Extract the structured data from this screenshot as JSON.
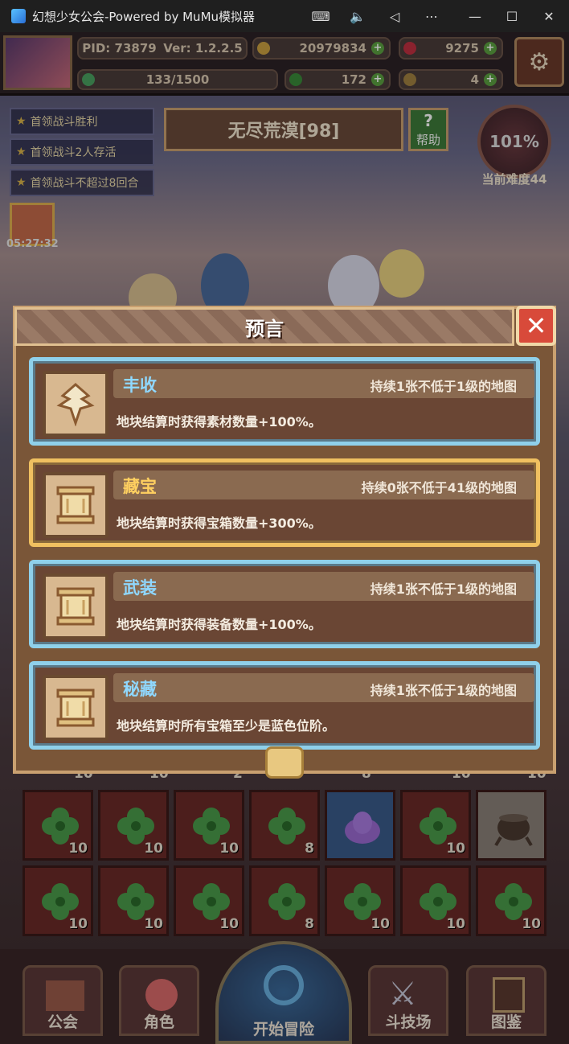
{
  "window": {
    "title": "幻想少女公会-Powered by MuMu模拟器",
    "controls": [
      "keyboard-icon",
      "volume-icon",
      "back-icon",
      "more-icon",
      "minimize-icon",
      "maximize-icon",
      "close-icon"
    ]
  },
  "status": {
    "pid": "PID: 73879",
    "version": "Ver: 1.2.2.5",
    "gold": "20979834",
    "gems": "9275",
    "stamina": "133/1500",
    "clover": "172",
    "item": "4"
  },
  "quests": [
    "首领战斗胜利",
    "首领战斗2人存活",
    "首领战斗不超过8回合"
  ],
  "stage": {
    "name": "无尽荒漠[98]",
    "help": "帮助"
  },
  "difficulty": {
    "percent": "101%",
    "label": "当前难度44"
  },
  "gift_timer": "05:27:32",
  "dialog": {
    "title": "预言",
    "cards": [
      {
        "name": "丰收",
        "condition": "持续1张不低于1级的地图",
        "desc": "地块结算时获得素材数量+100%。",
        "frame": "blue",
        "icon": "harvest-icon",
        "name_color": "#8fd8ff"
      },
      {
        "name": "藏宝",
        "condition": "持续0张不低于41级的地图",
        "desc": "地块结算时获得宝箱数量+300%。",
        "frame": "gold",
        "icon": "scroll-icon",
        "name_color": "#ffd060"
      },
      {
        "name": "武装",
        "condition": "持续1张不低于1级的地图",
        "desc": "地块结算时获得装备数量+100%。",
        "frame": "blue",
        "icon": "scroll-icon",
        "name_color": "#8fd8ff"
      },
      {
        "name": "秘藏",
        "condition": "持续1张不低于1级的地图",
        "desc": "地块结算时所有宝箱至少是蓝色位阶。",
        "frame": "blue",
        "icon": "scroll-icon",
        "name_color": "#8fd8ff"
      }
    ]
  },
  "grid_partial_counts": [
    "10",
    "10",
    "2",
    "8",
    "10",
    "10"
  ],
  "grid": {
    "row1": [
      {
        "item": "clover-icon",
        "count": "10"
      },
      {
        "item": "clover-icon",
        "count": "10"
      },
      {
        "item": "clover-icon",
        "count": "10"
      },
      {
        "item": "clover-icon",
        "count": "8"
      },
      {
        "item": "slime-icon",
        "count": ""
      },
      {
        "item": "clover-icon",
        "count": "10"
      },
      {
        "item": "cauldron-icon",
        "count": ""
      }
    ],
    "row2": [
      {
        "item": "clover-icon",
        "count": "10"
      },
      {
        "item": "clover-icon",
        "count": "10"
      },
      {
        "item": "clover-icon",
        "count": "10"
      },
      {
        "item": "clover-icon",
        "count": "8"
      },
      {
        "item": "clover-icon",
        "count": "10"
      },
      {
        "item": "clover-icon",
        "count": "10"
      },
      {
        "item": "clover-icon",
        "count": "10"
      }
    ]
  },
  "nav": {
    "guild": "公会",
    "character": "角色",
    "start": "开始冒险",
    "arena": "斗技场",
    "codex": "图鉴"
  }
}
